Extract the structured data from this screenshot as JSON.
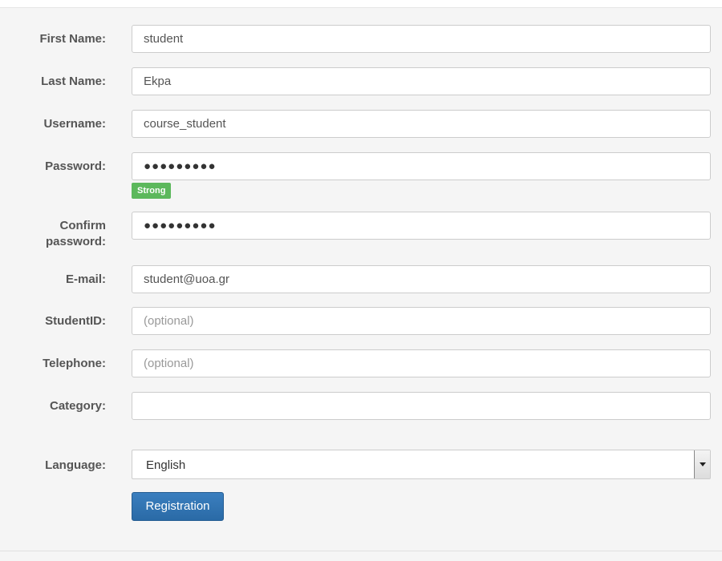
{
  "form": {
    "first_name": {
      "label": "First Name:",
      "value": "student"
    },
    "last_name": {
      "label": "Last Name:",
      "value": "Ekpa"
    },
    "username": {
      "label": "Username:",
      "value": "course_student"
    },
    "password": {
      "label": "Password:",
      "value": "●●●●●●●●●",
      "strength": "Strong"
    },
    "confirm_password": {
      "label_line1": "Confirm",
      "label_line2": "password:",
      "value": "●●●●●●●●●"
    },
    "email": {
      "label": "E-mail:",
      "value": "student@uoa.gr"
    },
    "student_id": {
      "label": "StudentID:",
      "placeholder": "(optional)"
    },
    "telephone": {
      "label": "Telephone:",
      "placeholder": "(optional)"
    },
    "category": {
      "label": "Category:",
      "value": ""
    },
    "language": {
      "label": "Language:",
      "selected": "English"
    },
    "submit_label": "Registration"
  },
  "colors": {
    "strength_badge": "#5cb85c",
    "primary_button": "#2f72b1",
    "label_text": "#555555"
  }
}
